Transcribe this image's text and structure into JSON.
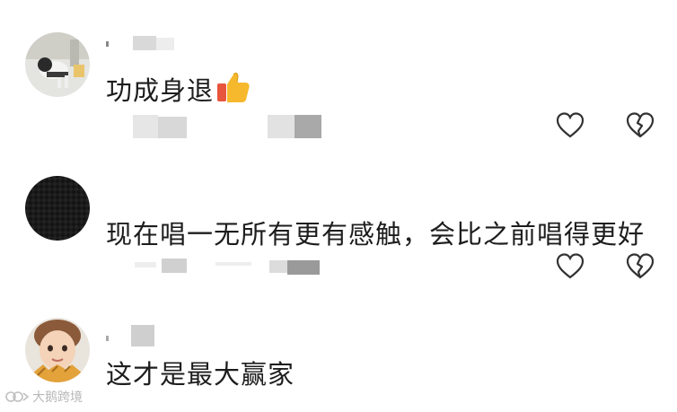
{
  "comments": [
    {
      "text": "功成身退",
      "emoji": "thumbs-up-emoji",
      "like_icon": "heart-outline-icon",
      "dislike_icon": "broken-heart-icon"
    },
    {
      "text": "现在唱一无所有更有感触，会比之前唱得更好",
      "like_icon": "heart-outline-icon",
      "dislike_icon": "broken-heart-icon"
    },
    {
      "text": "这才是最大赢家"
    }
  ],
  "watermark": {
    "text": "大鹅跨境"
  },
  "colors": {
    "text": "#1d1d1d",
    "blur_gray": "#d9d9d9",
    "icon_stroke": "#333333",
    "watermark": "#b8b8b8"
  }
}
